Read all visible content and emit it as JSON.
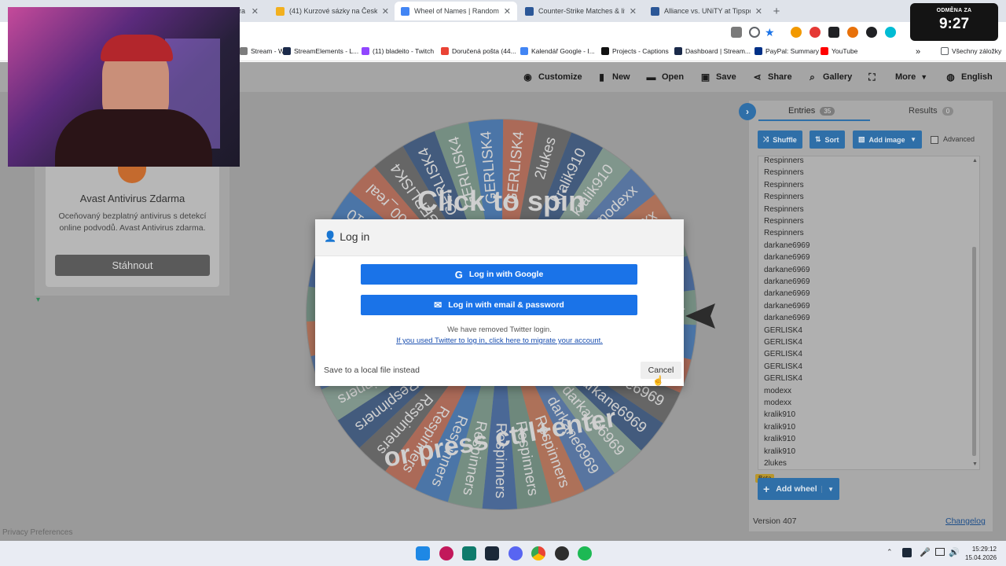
{
  "browser": {
    "tabs": [
      {
        "title": "…era",
        "color": "#6b6b6b"
      },
      {
        "title": "(41) Kurzové sázky na Česká Tip",
        "color": "#f2b01e"
      },
      {
        "title": "Wheel of Names | Random nam",
        "color": "#4285f4",
        "active": true
      },
      {
        "title": "Counter-Strike Matches & lives",
        "color": "#2b5797"
      },
      {
        "title": "Alliance vs. UNiTY at Tipsport C",
        "color": "#2b5797"
      }
    ],
    "new_tab": "+",
    "bookmarks": [
      {
        "label": "Stream - W...",
        "color": "#7d7d7d"
      },
      {
        "label": "StreamElements - L...",
        "color": "#1b2a4a"
      },
      {
        "label": "(11) bladeito - Twitch",
        "color": "#9146ff"
      },
      {
        "label": "Doručená pošta (44...",
        "color": "#ea4335"
      },
      {
        "label": "Kalendář Google - I...",
        "color": "#4285f4"
      },
      {
        "label": "Projects - Captions",
        "color": "#111111"
      },
      {
        "label": "Dashboard | Stream...",
        "color": "#1b2a4a"
      },
      {
        "label": "PayPal: Summary",
        "color": "#003087"
      },
      {
        "label": "YouTube",
        "color": "#ff0000"
      }
    ],
    "bookmarks_overflow": "»",
    "all_bookmarks": "Všechny záložky"
  },
  "timer": {
    "label": "ODMĚNA ZA",
    "value": "9:27"
  },
  "navbar": {
    "customize": "Customize",
    "new": "New",
    "open": "Open",
    "save": "Save",
    "share": "Share",
    "gallery": "Gallery",
    "more": "More",
    "language": "English"
  },
  "ad": {
    "title": "Avast Antivirus Zdarma",
    "text": "Oceňovaný bezplatný antivirus s detekcí online podvodů. Avast Antivirus zdarma.",
    "button": "Stáhnout"
  },
  "privacy": "Privacy Preferences",
  "wheel": {
    "overlay_top": "Click to spin",
    "overlay_bottom": "or press ctrl+enter",
    "segments": [
      "GERLISK4",
      "GERLISK4",
      "GERLISK4",
      "2lukes",
      "kralik910",
      "kralik910",
      "modexx",
      "modexx",
      "GERLISK4",
      "GERLISK4",
      "GERLISK4",
      "GERLISK4",
      "darkane6969",
      "darkane6969",
      "darkane6969",
      "darkane6969",
      "darkane6969",
      "Respinners",
      "Respinners",
      "Respinners",
      "Respinners",
      "Respinners",
      "Respinners",
      "Respinners",
      "Respinners",
      "Respinners",
      "Respinners",
      "Respinners",
      "Respinners",
      "Respinners",
      "Respinners",
      "kralik910",
      "bo0_real",
      "GERLISK4",
      "GERLISK4"
    ],
    "colors": [
      "#6f8f80",
      "#3a6fb0",
      "#b5614a",
      "#5c5c5c",
      "#2f4e7a",
      "#7d9a8d",
      "#4a6fa6",
      "#b76a4c",
      "#668878",
      "#385f9a"
    ]
  },
  "panel": {
    "tab_entries": "Entries",
    "entries_count": "35",
    "tab_results": "Results",
    "results_count": "0",
    "shuffle": "Shuffle",
    "sort": "Sort",
    "add_image": "Add image",
    "advanced": "Advanced",
    "entries": [
      "Respinners",
      "Respinners",
      "Respinners",
      "Respinners",
      "Respinners",
      "Respinners",
      "Respinners",
      "darkane6969",
      "darkane6969",
      "darkane6969",
      "darkane6969",
      "darkane6969",
      "darkane6969",
      "darkane6969",
      "GERLISK4",
      "GERLISK4",
      "GERLISK4",
      "GERLISK4",
      "GERLISK4",
      "modexx",
      "modexx",
      "kralik910",
      "kralik910",
      "kralik910",
      "kralik910",
      "2lukes"
    ],
    "beta": "Beta",
    "add_wheel": "Add wheel",
    "version": "Version 407",
    "changelog": "Changelog"
  },
  "modal": {
    "title": "Log in",
    "google": "Log in with Google",
    "email": "Log in with email & password",
    "notice": "We have removed Twitter login.",
    "migrate_link": "If you used Twitter to log in, click here to migrate your account.",
    "local": "Save to a local file instead",
    "cancel": "Cancel"
  },
  "taskbar": {
    "time": "15:29:12",
    "date": "15.04.2026"
  }
}
